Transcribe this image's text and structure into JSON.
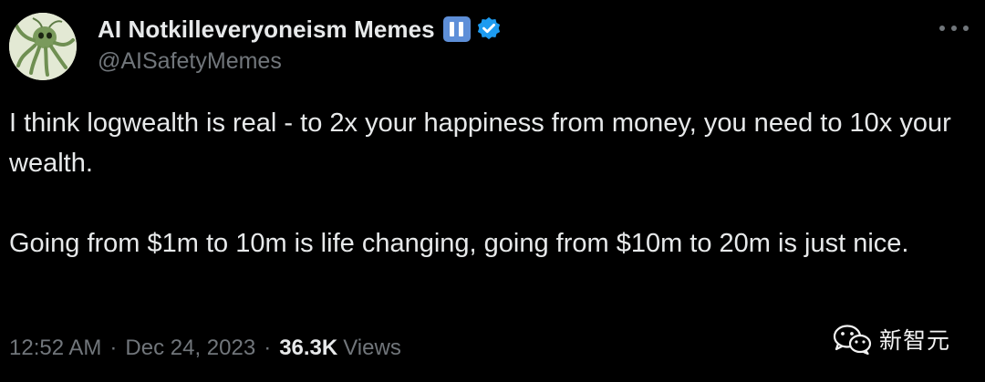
{
  "author": {
    "display_name": "AI Notkilleveryoneism Memes",
    "handle": "@AISafetyMemes",
    "badge_icon": "pause-icon",
    "verified_icon": "verified-badge-icon",
    "badge_color": "#5e8fd8",
    "verified_color": "#1d9bf0"
  },
  "tweet": {
    "paragraphs": [
      "I think logwealth is real - to 2x your happiness from money, you need to 10x your wealth.",
      "Going from $1m to 10m is life changing, going from $10m to 20m is just nice."
    ]
  },
  "meta": {
    "time": "12:52 AM",
    "separator": "·",
    "date": "Dec 24, 2023",
    "views_count": "36.3K",
    "views_label": "Views"
  },
  "more_icon": "more-dots-icon",
  "watermark": {
    "icon": "wechat-icon",
    "text": "新智元"
  },
  "colors": {
    "background": "#000000",
    "text_primary": "#e7e9ea",
    "text_secondary": "#71767b"
  }
}
